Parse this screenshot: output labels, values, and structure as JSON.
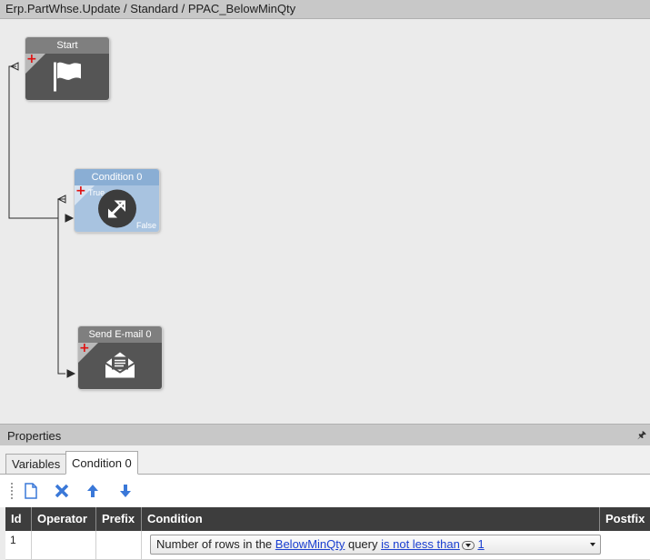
{
  "window": {
    "breadcrumb": "Erp.PartWhse.Update / Standard / PPAC_BelowMinQty"
  },
  "canvas": {
    "nodes": {
      "start": {
        "title": "Start",
        "icon": "flag-icon"
      },
      "condition": {
        "title": "Condition 0",
        "icon": "expand-arrows-icon",
        "true_label": "True",
        "false_label": "False"
      },
      "email": {
        "title": "Send E-mail 0",
        "icon": "envelope-icon"
      }
    },
    "add_glyph": "+"
  },
  "properties": {
    "header": "Properties",
    "pin_glyph": "🖈",
    "tabs": [
      {
        "label": "Variables",
        "active": false
      },
      {
        "label": "Condition 0",
        "active": true
      }
    ],
    "toolbar": [
      "new-icon",
      "delete-icon",
      "move-up-icon",
      "move-down-icon"
    ],
    "grid": {
      "columns": [
        "Id",
        "Operator",
        "Prefix",
        "Condition",
        "Postfix"
      ],
      "rows": [
        {
          "id": "1",
          "operator": "",
          "prefix": "",
          "condition": {
            "text_before": "Number of rows in the ",
            "query_link": "BelowMinQty",
            "text_mid": " query ",
            "comparison_link": "is not less than",
            "value_link": "1"
          },
          "postfix": ""
        }
      ]
    }
  },
  "colors": {
    "node_dark": "#555555",
    "node_condition": "#a8c3e0",
    "add_red": "#e01010",
    "link_blue": "#1a3fd0",
    "toolbar_blue": "#3a78d8"
  }
}
